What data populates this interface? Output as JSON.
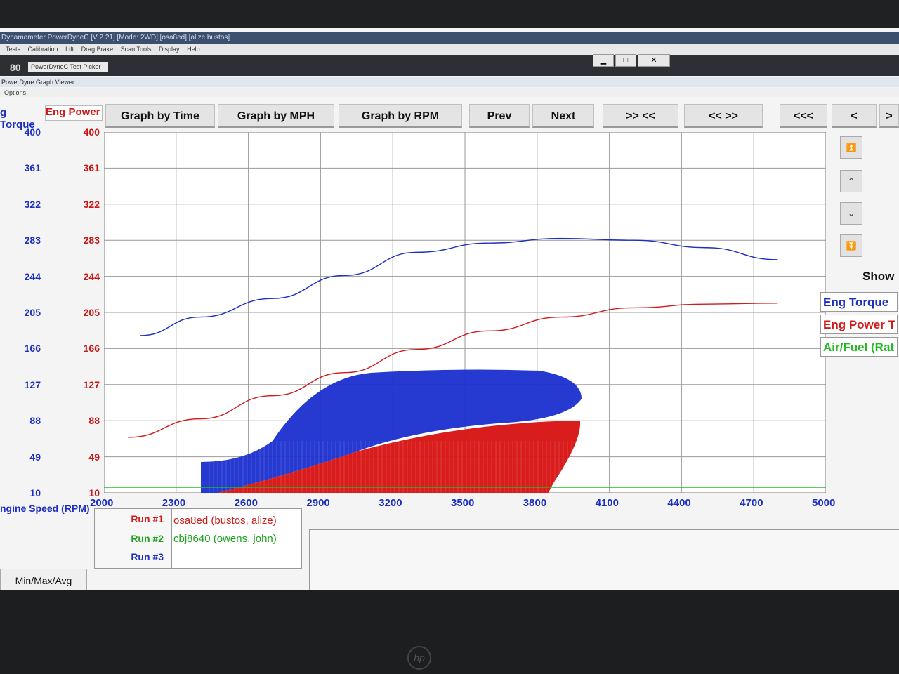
{
  "window": {
    "title": "Dynamometer PowerDyneC [V 2.21] [Mode: 2WD] [osa8ed] [alize bustos]",
    "menu": [
      "Tests",
      "Calibration",
      "Lift",
      "Drag Brake",
      "Scan Tools",
      "Display",
      "Help"
    ],
    "min_btn": "▁",
    "max_btn": "□",
    "close_btn": "✕",
    "sub_number": "80",
    "picker_title": "PowerDyneC Test Picker"
  },
  "viewer": {
    "title": "PowerDyne Graph Viewer",
    "options_label": "Options"
  },
  "toolbar": {
    "graph_by_time": "Graph by Time",
    "graph_by_mph": "Graph by MPH",
    "graph_by_rpm": "Graph by RPM",
    "prev": "Prev",
    "next": "Next",
    "zoom_in": ">> <<",
    "zoom_out": "<< >>",
    "rewind": "<<<",
    "left": "<",
    "right": ">"
  },
  "axes": {
    "left_header": "g Torque",
    "right_header": "Eng Power",
    "x_label": "ngine Speed (RPM)",
    "y_ticks": [
      "400",
      "361",
      "322",
      "283",
      "244",
      "205",
      "166",
      "127",
      "88",
      "49",
      "10"
    ],
    "x_ticks": [
      "2000",
      "2300",
      "2600",
      "2900",
      "3200",
      "3500",
      "3800",
      "4100",
      "4400",
      "4700",
      "5000"
    ]
  },
  "runs": [
    {
      "label": "Run #1",
      "value": "osa8ed (bustos, alize)",
      "color": "#d11a1a"
    },
    {
      "label": "Run #2",
      "value": "cbj8640 (owens, john)",
      "color": "#1aa31a"
    },
    {
      "label": "Run #3",
      "value": "",
      "color": "#1c2fbf"
    }
  ],
  "minmax_label": "Min/Max/Avg",
  "legend": {
    "show_label": "Show",
    "items": [
      {
        "name": "Eng Torque",
        "color": "#1c2fbf"
      },
      {
        "name": "Eng Power T",
        "color": "#d11a1a"
      },
      {
        "name": "Air/Fuel (Rat",
        "color": "#22bb22"
      }
    ]
  },
  "scroll_icons": [
    "double-up-icon",
    "up-icon",
    "down-icon",
    "double-down-icon"
  ],
  "chart_data": {
    "type": "line",
    "x_unit": "RPM",
    "xlim": [
      2000,
      5000
    ],
    "ylim": [
      10,
      400
    ],
    "series": [
      {
        "name": "Eng Torque",
        "color": "#1c2fbf",
        "x": [
          2150,
          2400,
          2700,
          3000,
          3300,
          3600,
          3900,
          4200,
          4500,
          4800
        ],
        "y": [
          180,
          200,
          220,
          245,
          270,
          280,
          285,
          283,
          275,
          262
        ]
      },
      {
        "name": "Eng Power",
        "color": "#d11a1a",
        "x": [
          2100,
          2400,
          2700,
          3000,
          3300,
          3600,
          3900,
          4200,
          4500,
          4800
        ],
        "y": [
          70,
          90,
          115,
          140,
          165,
          185,
          200,
          210,
          214,
          215
        ]
      }
    ]
  }
}
